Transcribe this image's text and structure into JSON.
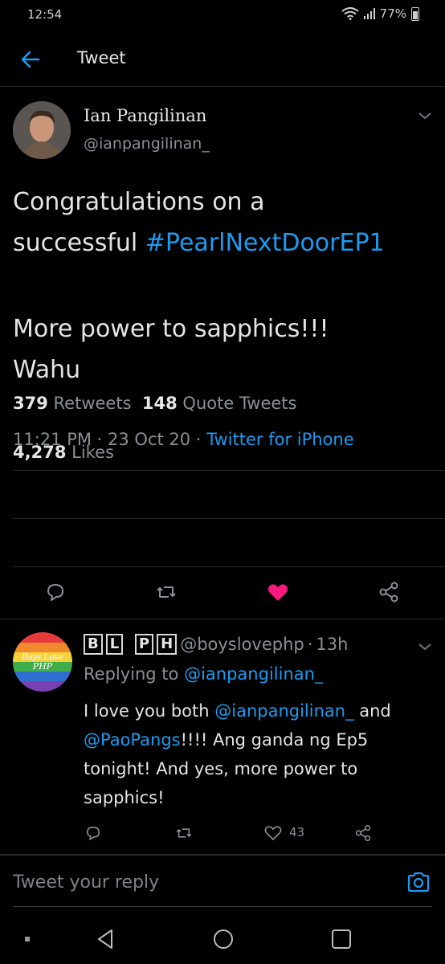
{
  "status": {
    "time": "12:54",
    "battery": "77%"
  },
  "header": {
    "title": "Tweet"
  },
  "tweet": {
    "name": "Ian Pangilinan",
    "handle": "@ianpangilinan_",
    "text_line1": "Congratulations on a",
    "text_line2a": "successful ",
    "hashtag": "#PearlNextDoorEP1",
    "emoji": "",
    "text_line4": "More power to sapphics!!!",
    "text_line5": "Wahu",
    "time": "11:21 PM",
    "date": "23 Oct 20",
    "source": "Twitter for iPhone",
    "retweets": "379",
    "retweets_label": "Retweets",
    "quotes": "148",
    "quotes_label": "Quote Tweets",
    "likes": "4,278",
    "likes_label": "Likes"
  },
  "reply": {
    "name_b": "B",
    "name_l": "L",
    "name_p": "P",
    "name_h": "H",
    "handle": "@boyslovephp",
    "age": "13h",
    "replying_prefix": "Replying to",
    "replying_to": "@ianpangilinan_",
    "text_a": "I love you both ",
    "mention1": "@ianpangilinan_",
    "text_b": " and ",
    "mention2": "@PaoPangs",
    "text_c": "!!!! Ang ganda ng Ep5 tonight! And yes, more power to sapphics!",
    "like_count": "43"
  },
  "reply_bar": {
    "placeholder": "Tweet your reply"
  },
  "colors": {
    "accent": "#1d9bf0",
    "like": "#f91880",
    "background": "#000000"
  }
}
